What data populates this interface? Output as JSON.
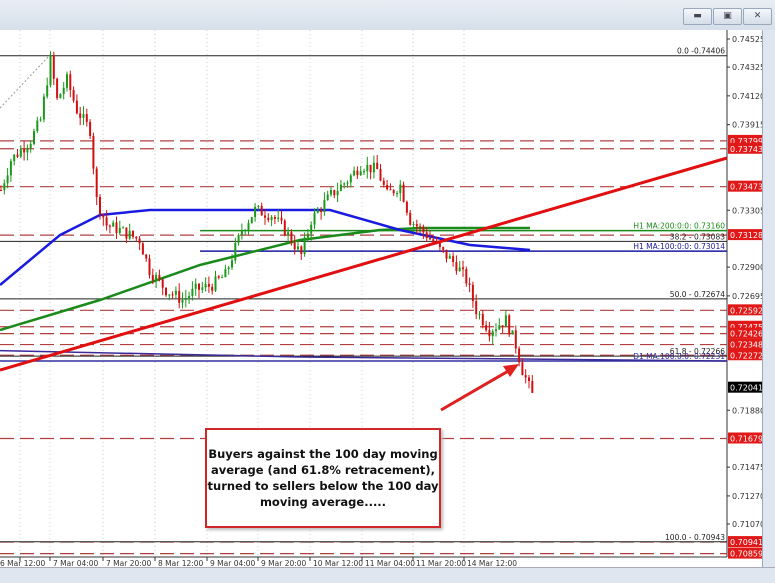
{
  "window": {
    "buttons": [
      "minimize",
      "restore",
      "close"
    ]
  },
  "annotation": "Buyers against the 100 day moving average (and 61.8% retracement), turned to sellers below the 100 day moving average.....",
  "chart_data": {
    "type": "candlestick",
    "symbol_timeframe": "H1",
    "y_ticks": [
      "0.74525",
      "0.74325",
      "0.74120",
      "0.73915",
      "0.73305",
      "0.72900",
      "0.72695",
      "0.71880",
      "0.71475",
      "0.71270",
      "0.71070"
    ],
    "y_range": [
      0.7082,
      0.7457
    ],
    "x_ticks": [
      "6 Mar 12:00",
      "7 Mar 04:00",
      "7 Mar 20:00",
      "8 Mar 12:00",
      "9 Mar 04:00",
      "9 Mar 20:00",
      "10 Mar 12:00",
      "11 Mar 04:00",
      "11 Mar 20:00",
      "14 Mar 12:00"
    ],
    "price_path": [
      [
        0,
        0.73449
      ],
      [
        3,
        0.73663
      ],
      [
        6,
        0.73734
      ],
      [
        9,
        0.73806
      ],
      [
        12,
        0.73948
      ],
      [
        15,
        0.74375
      ],
      [
        17,
        0.7409
      ],
      [
        20,
        0.74233
      ],
      [
        23,
        0.74019
      ],
      [
        27,
        0.73877
      ],
      [
        29,
        0.73378
      ],
      [
        32,
        0.732
      ],
      [
        36,
        0.73164
      ],
      [
        42,
        0.73093
      ],
      [
        45,
        0.72879
      ],
      [
        50,
        0.72737
      ],
      [
        55,
        0.72666
      ],
      [
        59,
        0.72737
      ],
      [
        64,
        0.72772
      ],
      [
        68,
        0.72844
      ],
      [
        73,
        0.73164
      ],
      [
        77,
        0.73307
      ],
      [
        82,
        0.73271
      ],
      [
        86,
        0.73164
      ],
      [
        91,
        0.72986
      ],
      [
        94,
        0.73236
      ],
      [
        100,
        0.73414
      ],
      [
        105,
        0.7352
      ],
      [
        109,
        0.73627
      ],
      [
        114,
        0.73592
      ],
      [
        117,
        0.73414
      ],
      [
        121,
        0.73485
      ],
      [
        124,
        0.73236
      ],
      [
        129,
        0.73129
      ],
      [
        133,
        0.73022
      ],
      [
        138,
        0.72915
      ],
      [
        141,
        0.72808
      ],
      [
        144,
        0.72594
      ],
      [
        148,
        0.72452
      ],
      [
        153,
        0.72523
      ],
      [
        156,
        0.72345
      ],
      [
        158,
        0.72167
      ],
      [
        161,
        0.71989
      ]
    ],
    "current_price": "0.72041",
    "red_levels": [
      "0.73799",
      "0.73743",
      "0.73473",
      "0.73128",
      "0.72592",
      "0.72475",
      "0.72426",
      "0.72348",
      "0.72272",
      "0.71679",
      "0.70941",
      "0.70859"
    ],
    "fib_levels": [
      {
        "label": "0.0 -0.74406",
        "price": 0.74406
      },
      {
        "label": "38.2 - 0.73083",
        "price": 0.73083
      },
      {
        "label": "50.0 - 0.72674",
        "price": 0.72674
      },
      {
        "label": "61.8 - 0.72266",
        "price": 0.72266
      },
      {
        "label": "100.0 - 0.70943",
        "price": 0.70943
      }
    ],
    "ma_labels": [
      {
        "label": "H1 MA:200:0:0: 0.73160",
        "price": 0.7316,
        "color": "#1a8a1a"
      },
      {
        "label": "H1 MA:100:0:0: 0.73014",
        "price": 0.73014,
        "color": "#1a1aa0"
      },
      {
        "label": "D1 MA:100:0:0: 0.72231",
        "price": 0.72231,
        "color": "#3030a0"
      }
    ],
    "colors": {
      "up": "#1a9a1a",
      "down": "#d01010",
      "ma100": "#1a1ae0",
      "ma200": "#1a8a1a",
      "trend": "#e01010",
      "level": "#b04040"
    }
  }
}
